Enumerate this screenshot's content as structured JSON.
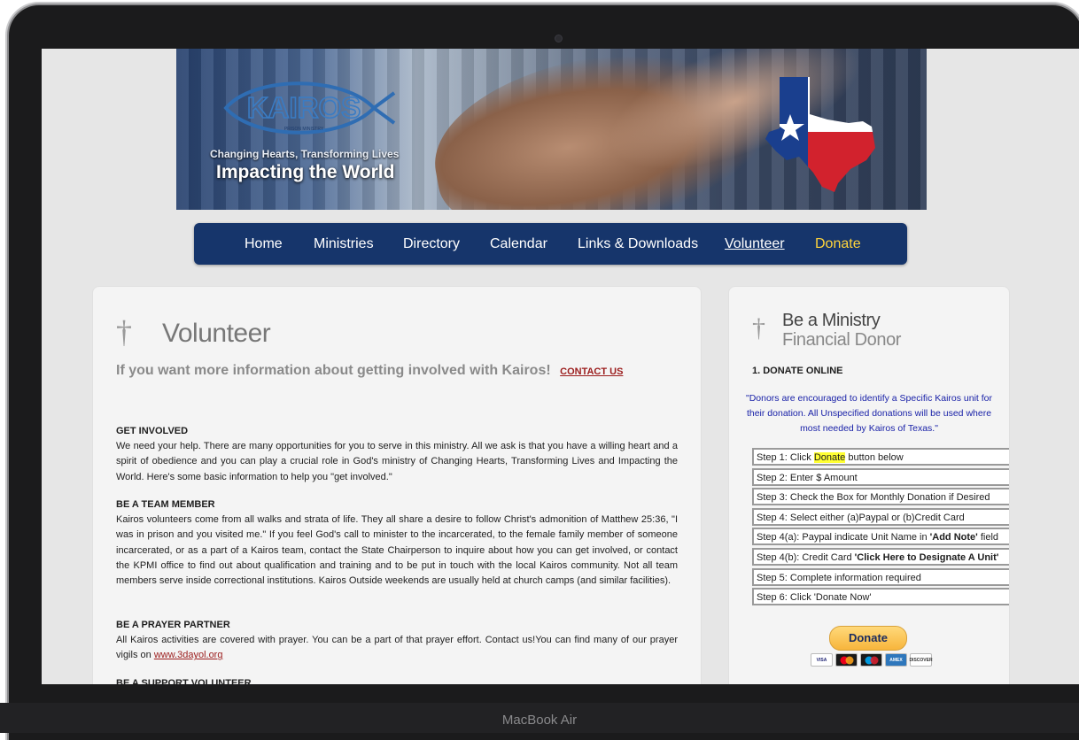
{
  "device": {
    "label": "MacBook Air"
  },
  "banner": {
    "logo_text": "KAIROS",
    "logo_subtext": "PRISON MINISTRY",
    "tagline": "Changing Hearts, Transforming Lives",
    "headline": "Impacting the World"
  },
  "nav": {
    "items": [
      {
        "label": "Home"
      },
      {
        "label": "Ministries"
      },
      {
        "label": "Directory"
      },
      {
        "label": "Calendar"
      },
      {
        "label": "Links & Downloads"
      },
      {
        "label": "Volunteer"
      },
      {
        "label": "Donate"
      }
    ]
  },
  "main": {
    "title": "Volunteer",
    "intro": "If you want more information about getting involved with Kairos!",
    "contact_link": "CONTACT US",
    "sections": [
      {
        "heading": "GET INVOLVED",
        "text": "We need your help. There are many opportunities for you to serve in this ministry. All we ask is that you have a willing heart and a spirit of obedience and you can play a crucial role in God's ministry of Changing Hearts, Transforming Lives and Impacting the World. Here's some basic information to help you \"get involved.\""
      },
      {
        "heading": "BE A TEAM MEMBER",
        "text": "Kairos volunteers come from all walks and strata of life. They all share a desire to follow Christ's admonition of Matthew 25:36, \"I was in prison and you visited me.\" If you feel God's call to minister to the incarcerated, to the female family member of someone incarcerated, or as a part of a Kairos team, contact the State Chairperson to inquire about how you can get involved, or contact the KPMI office to find out about qualification and training and to be put in touch with the local Kairos community. Not all team members serve inside correctional institutions. Kairos Outside weekends are usually held at church camps (and similar facilities)."
      },
      {
        "heading": "BE A PRAYER PARTNER",
        "text": "All Kairos activities are covered with prayer. You can be a part of that prayer effort. Contact us!You can find many of our prayer vigils on",
        "link": "www.3dayol.org"
      },
      {
        "heading": "BE A SUPPORT VOLUNTEER"
      }
    ]
  },
  "sidebar": {
    "title_line1": "Be a Ministry",
    "title_line2": "Financial Donor",
    "subheading": "1. DONATE ONLINE",
    "quote": "\"Donors are encouraged to identify a Specific Kairos unit for their donation. All Unspecified donations will be used where most needed by Kairos of Texas.\"",
    "steps": {
      "s1_pre": "Step 1: Click ",
      "s1_highlight": "Donate",
      "s1_post": " button below",
      "s2": "Step 2: Enter $ Amount",
      "s3": "Step 3: Check the Box for Monthly Donation if Desired",
      "s4": "Step 4: Select either (a)Paypal or (b)Credit Card",
      "s4a_pre": "Step 4(a): Paypal indicate Unit Name in ",
      "s4a_bold": "'Add Note'",
      "s4a_post": " field",
      "s4b_pre": "Step 4(b): Credit Card ",
      "s4b_bold": "'Click Here to Designate A Unit'",
      "s5": "Step 5: Complete information required",
      "s6": "Step 6: Click 'Donate Now'"
    },
    "donate_button": "Donate",
    "cards": [
      "VISA",
      "MC",
      "MAESTRO",
      "AMEX",
      "DISCOVER"
    ]
  },
  "colors": {
    "nav_bg": "#16356b",
    "donate_nav": "#ffd43b",
    "link_red": "#9b1c1c",
    "quote_blue": "#1a22a8",
    "highlight": "#ffff33"
  }
}
